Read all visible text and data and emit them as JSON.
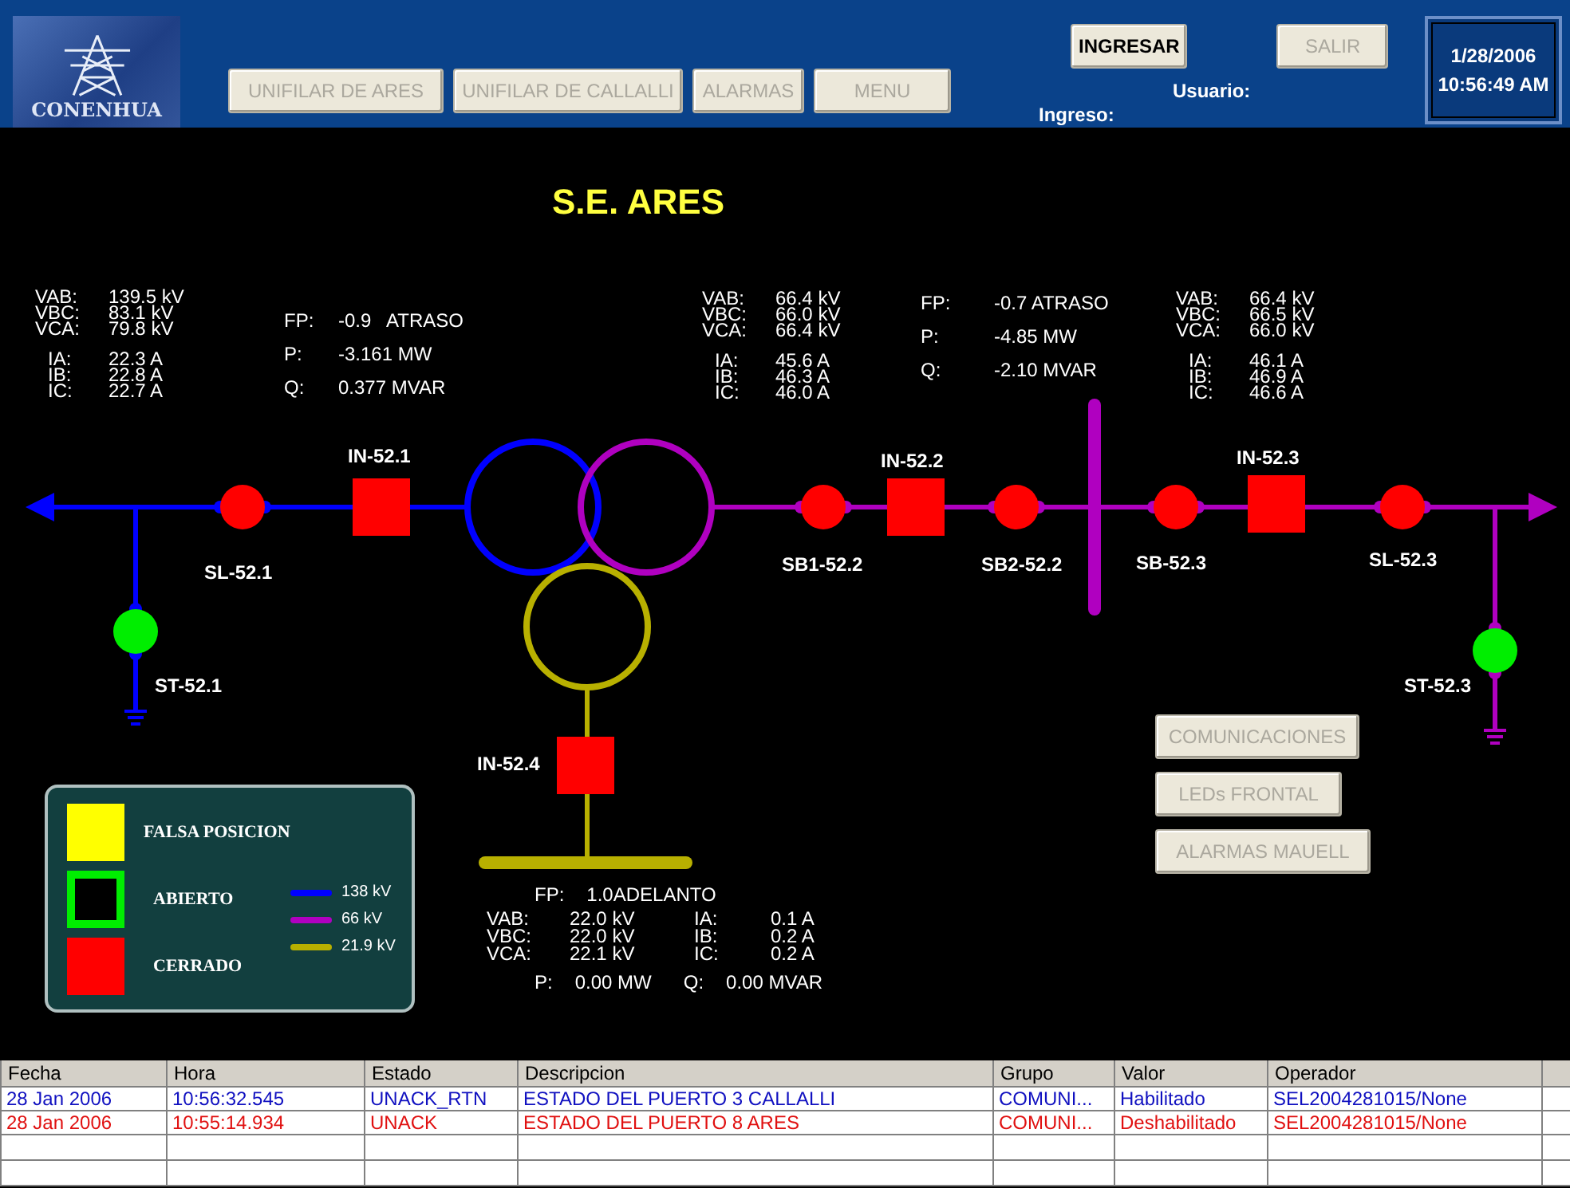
{
  "header": {
    "logo_text": "CONENHUA",
    "nav_buttons": [
      {
        "label": "UNIFILAR DE ARES",
        "disabled": true
      },
      {
        "label": "UNIFILAR DE CALLALLI",
        "disabled": true
      },
      {
        "label": "ALARMAS",
        "disabled": true
      },
      {
        "label": "MENU",
        "disabled": true
      }
    ],
    "login_buttons": [
      {
        "label": "INGRESAR",
        "disabled": false
      },
      {
        "label": "SALIR",
        "disabled": true
      }
    ],
    "user_label": "Usuario:",
    "login_label": "Ingreso:",
    "date": "1/28/2006",
    "time": "10:56:49 AM"
  },
  "title": "S.E. ARES",
  "meters": [
    {
      "kind": "vi",
      "rows": [
        [
          "VAB:",
          "139.5 kV"
        ],
        [
          "VBC:",
          "83.1 kV"
        ],
        [
          "VCA:",
          "79.8 kV"
        ],
        [
          "IA:",
          "22.3 A"
        ],
        [
          "IB:",
          "22.8 A"
        ],
        [
          "IC:",
          "22.7 A"
        ]
      ]
    },
    {
      "kind": "pq",
      "rows": [
        [
          "FP:",
          "-0.9   ATRASO"
        ],
        [
          "P:",
          "-3.161 MW"
        ],
        [
          "Q:",
          "0.377 MVAR"
        ]
      ]
    },
    {
      "kind": "vi",
      "rows": [
        [
          "VAB:",
          "66.4 kV"
        ],
        [
          "VBC:",
          "66.0 kV"
        ],
        [
          "VCA:",
          "66.4 kV"
        ],
        [
          "IA:",
          "45.6 A"
        ],
        [
          "IB:",
          "46.3 A"
        ],
        [
          "IC:",
          "46.0 A"
        ]
      ]
    },
    {
      "kind": "pq",
      "rows": [
        [
          "FP:",
          "-0.7 ATRASO"
        ],
        [
          "P:",
          "-4.85 MW"
        ],
        [
          "Q:",
          "-2.10 MVAR"
        ]
      ]
    },
    {
      "kind": "vi",
      "rows": [
        [
          "VAB:",
          "66.4 kV"
        ],
        [
          "VBC:",
          "66.5 kV"
        ],
        [
          "VCA:",
          "66.0 kV"
        ],
        [
          "IA:",
          "46.1 A"
        ],
        [
          "IB:",
          "46.9 A"
        ],
        [
          "IC:",
          "46.6 A"
        ]
      ]
    },
    {
      "kind": "tertiary",
      "rows": [
        [
          "FP:",
          "1.0ADELANTO"
        ],
        [
          "VAB:",
          "22.0 kV",
          "IA:",
          "0.1 A"
        ],
        [
          "VBC:",
          "22.0 kV",
          "IB:",
          "0.2 A"
        ],
        [
          "VCA:",
          "22.1 kV",
          "IC:",
          "0.2 A"
        ],
        [
          "P:",
          "0.00 MW",
          "Q:",
          "0.00 MVAR"
        ]
      ]
    }
  ],
  "devices": [
    {
      "label": "SL-52.1",
      "kind": "switch",
      "closed": true
    },
    {
      "label": "IN-52.1",
      "kind": "breaker",
      "closed": true
    },
    {
      "label": "ST-52.1",
      "kind": "switch",
      "closed": false
    },
    {
      "label": "SB1-52.2",
      "kind": "switch",
      "closed": true
    },
    {
      "label": "IN-52.2",
      "kind": "breaker",
      "closed": true
    },
    {
      "label": "SB2-52.2",
      "kind": "switch",
      "closed": true
    },
    {
      "label": "SB-52.3",
      "kind": "switch",
      "closed": true
    },
    {
      "label": "IN-52.3",
      "kind": "breaker",
      "closed": true
    },
    {
      "label": "SL-52.3",
      "kind": "switch",
      "closed": true
    },
    {
      "label": "ST-52.3",
      "kind": "switch",
      "closed": false
    },
    {
      "label": "IN-52.4",
      "kind": "breaker",
      "closed": true
    }
  ],
  "side_buttons": [
    {
      "label": "COMUNICACIONES",
      "disabled": true
    },
    {
      "label": "LEDs FRONTAL",
      "disabled": true
    },
    {
      "label": "ALARMAS MAUELL",
      "disabled": true
    }
  ],
  "legend": {
    "states": [
      {
        "label": "FALSA POSICION",
        "kind": "false-position"
      },
      {
        "label": "ABIERTO",
        "kind": "open"
      },
      {
        "label": "CERRADO",
        "kind": "closed"
      }
    ],
    "levels": [
      {
        "label": "138 kV",
        "color": "#0000ff"
      },
      {
        "label": "66 kV",
        "color": "#b000c0"
      },
      {
        "label": "21.9 kV",
        "color": "#b8b000"
      }
    ]
  },
  "alarm_table": {
    "columns": [
      "Fecha",
      "Hora",
      "Estado",
      "Descripcion",
      "Grupo",
      "Valor",
      "Operador"
    ],
    "rows": [
      {
        "color": "#1010c0",
        "cells": [
          "28 Jan 2006",
          "10:56:32.545",
          "UNACK_RTN",
          "ESTADO DEL PUERTO 3 CALLALLI",
          "COMUNI...",
          "Habilitado",
          "SEL2004281015/None"
        ]
      },
      {
        "color": "#e01010",
        "cells": [
          "28 Jan 2006",
          "10:55:14.934",
          "UNACK",
          "ESTADO DEL PUERTO 8 ARES",
          "COMUNI...",
          "Deshabilitado",
          "SEL2004281015/None"
        ]
      }
    ]
  }
}
